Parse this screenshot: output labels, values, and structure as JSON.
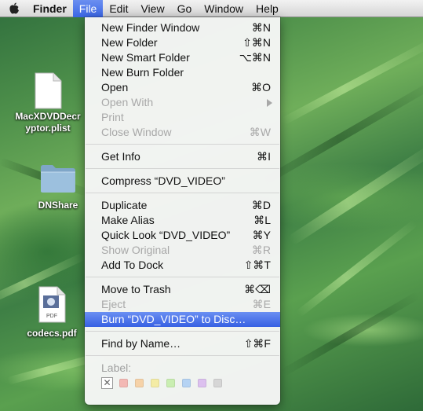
{
  "menubar": {
    "app_name": "Finder",
    "menus": [
      "File",
      "Edit",
      "View",
      "Go",
      "Window",
      "Help"
    ],
    "active_menu": "File",
    "apple_icon": "apple-icon"
  },
  "file_menu": {
    "items": [
      {
        "label": "New Finder Window",
        "shortcut": "⌘N"
      },
      {
        "label": "New Folder",
        "shortcut": "⇧⌘N"
      },
      {
        "label": "New Smart Folder",
        "shortcut": "⌥⌘N"
      },
      {
        "label": "New Burn Folder",
        "shortcut": ""
      },
      {
        "label": "Open",
        "shortcut": "⌘O"
      },
      {
        "label": "Open With",
        "shortcut": "",
        "disabled": true,
        "submenu": true
      },
      {
        "label": "Print",
        "shortcut": "",
        "disabled": true
      },
      {
        "label": "Close Window",
        "shortcut": "⌘W",
        "disabled": true
      },
      {
        "label": "Get Info",
        "shortcut": "⌘I"
      },
      {
        "label": "Compress “DVD_VIDEO”",
        "shortcut": ""
      },
      {
        "label": "Duplicate",
        "shortcut": "⌘D"
      },
      {
        "label": "Make Alias",
        "shortcut": "⌘L"
      },
      {
        "label": "Quick Look “DVD_VIDEO”",
        "shortcut": "⌘Y"
      },
      {
        "label": "Show Original",
        "shortcut": "⌘R",
        "disabled": true
      },
      {
        "label": "Add To Dock",
        "shortcut": "⇧⌘T"
      },
      {
        "label": "Move to Trash",
        "shortcut": "⌘⌫"
      },
      {
        "label": "Eject",
        "shortcut": "⌘E",
        "disabled": true
      },
      {
        "label": "Burn “DVD_VIDEO” to Disc…",
        "shortcut": "",
        "highlighted": true
      },
      {
        "label": "Find by Name…",
        "shortcut": "⇧⌘F"
      }
    ],
    "label_header": "Label:",
    "label_colors": [
      "#f3b8b4",
      "#f6d2a8",
      "#f4eca5",
      "#c9eeb1",
      "#b5d3f3",
      "#dcc0ef",
      "#d6d6d6"
    ]
  },
  "desktop": {
    "icons": [
      {
        "name_line1": "MacXDVDDecr",
        "name_line2": "yptor.plist",
        "icon": "document-icon"
      },
      {
        "name_line1": "DNShare",
        "name_line2": "",
        "icon": "folder-icon"
      },
      {
        "name_line1": "codecs.pdf",
        "name_line2": "",
        "icon": "pdf-icon"
      }
    ]
  }
}
